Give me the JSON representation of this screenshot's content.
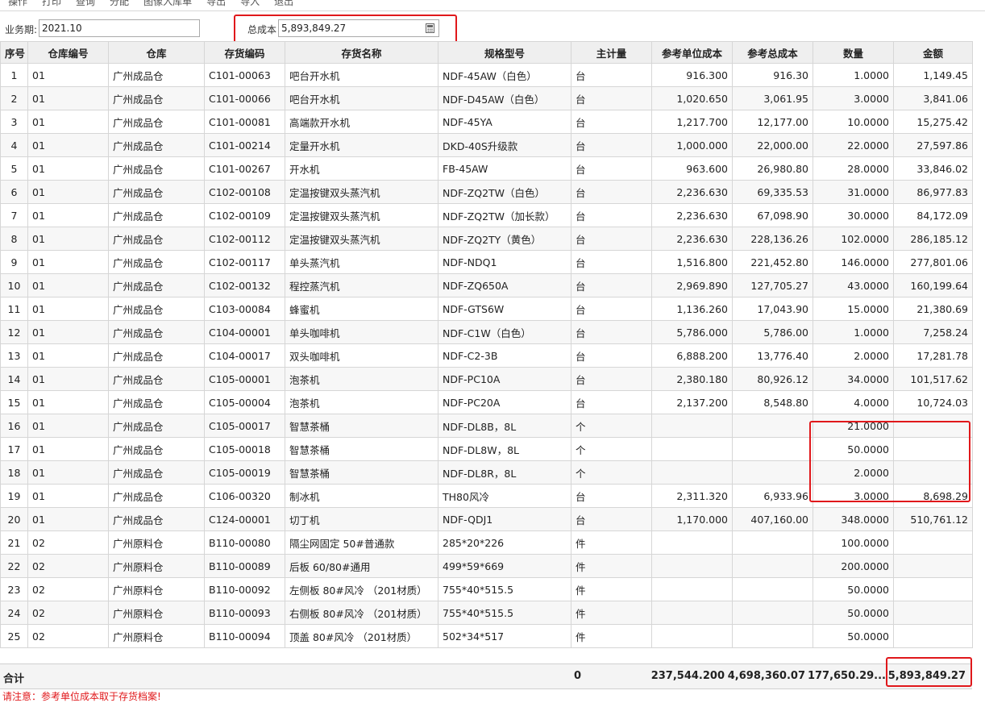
{
  "toolbar": [
    "操作",
    "打印",
    "查询",
    "分配",
    "图像入库单",
    "导出",
    "导入",
    "退出"
  ],
  "filters": {
    "period_label": "业务期:",
    "period_value": "2021.10",
    "total_cost_label": "总成本",
    "total_cost_value": "5,893,849.27"
  },
  "columns": [
    "序号",
    "仓库编号",
    "仓库",
    "存货编码",
    "存货名称",
    "规格型号",
    "主计量",
    "参考单位成本",
    "参考总成本",
    "数量",
    "金额"
  ],
  "rows": [
    [
      "1",
      "01",
      "广州成品仓",
      "C101-00063",
      "吧台开水机",
      "NDF-45AW（白色）",
      "台",
      "916.300",
      "916.30",
      "1.0000",
      "1,149.45"
    ],
    [
      "2",
      "01",
      "广州成品仓",
      "C101-00066",
      "吧台开水机",
      "NDF-D45AW（白色）",
      "台",
      "1,020.650",
      "3,061.95",
      "3.0000",
      "3,841.06"
    ],
    [
      "3",
      "01",
      "广州成品仓",
      "C101-00081",
      "高端款开水机",
      "NDF-45YA",
      "台",
      "1,217.700",
      "12,177.00",
      "10.0000",
      "15,275.42"
    ],
    [
      "4",
      "01",
      "广州成品仓",
      "C101-00214",
      "定量开水机",
      "DKD-40S升级款",
      "台",
      "1,000.000",
      "22,000.00",
      "22.0000",
      "27,597.86"
    ],
    [
      "5",
      "01",
      "广州成品仓",
      "C101-00267",
      "开水机",
      "FB-45AW",
      "台",
      "963.600",
      "26,980.80",
      "28.0000",
      "33,846.02"
    ],
    [
      "6",
      "01",
      "广州成品仓",
      "C102-00108",
      "定温按键双头蒸汽机",
      "NDF-ZQ2TW（白色）",
      "台",
      "2,236.630",
      "69,335.53",
      "31.0000",
      "86,977.83"
    ],
    [
      "7",
      "01",
      "广州成品仓",
      "C102-00109",
      "定温按键双头蒸汽机",
      "NDF-ZQ2TW（加长款）",
      "台",
      "2,236.630",
      "67,098.90",
      "30.0000",
      "84,172.09"
    ],
    [
      "8",
      "01",
      "广州成品仓",
      "C102-00112",
      "定温按键双头蒸汽机",
      "NDF-ZQ2TY（黄色）",
      "台",
      "2,236.630",
      "228,136.26",
      "102.0000",
      "286,185.12"
    ],
    [
      "9",
      "01",
      "广州成品仓",
      "C102-00117",
      "单头蒸汽机",
      "NDF-NDQ1",
      "台",
      "1,516.800",
      "221,452.80",
      "146.0000",
      "277,801.06"
    ],
    [
      "10",
      "01",
      "广州成品仓",
      "C102-00132",
      "程控蒸汽机",
      "NDF-ZQ650A",
      "台",
      "2,969.890",
      "127,705.27",
      "43.0000",
      "160,199.64"
    ],
    [
      "11",
      "01",
      "广州成品仓",
      "C103-00084",
      "蜂蜜机",
      "NDF-GTS6W",
      "台",
      "1,136.260",
      "17,043.90",
      "15.0000",
      "21,380.69"
    ],
    [
      "12",
      "01",
      "广州成品仓",
      "C104-00001",
      "单头咖啡机",
      "NDF-C1W（白色）",
      "台",
      "5,786.000",
      "5,786.00",
      "1.0000",
      "7,258.24"
    ],
    [
      "13",
      "01",
      "广州成品仓",
      "C104-00017",
      "双头咖啡机",
      "NDF-C2-3B",
      "台",
      "6,888.200",
      "13,776.40",
      "2.0000",
      "17,281.78"
    ],
    [
      "14",
      "01",
      "广州成品仓",
      "C105-00001",
      "泡茶机",
      "NDF-PC10A",
      "台",
      "2,380.180",
      "80,926.12",
      "34.0000",
      "101,517.62"
    ],
    [
      "15",
      "01",
      "广州成品仓",
      "C105-00004",
      "泡茶机",
      "NDF-PC20A",
      "台",
      "2,137.200",
      "8,548.80",
      "4.0000",
      "10,724.03"
    ],
    [
      "16",
      "01",
      "广州成品仓",
      "C105-00017",
      "智慧茶桶",
      "NDF-DL8B，8L",
      "个",
      "",
      "",
      "21.0000",
      ""
    ],
    [
      "17",
      "01",
      "广州成品仓",
      "C105-00018",
      "智慧茶桶",
      "NDF-DL8W，8L",
      "个",
      "",
      "",
      "50.0000",
      ""
    ],
    [
      "18",
      "01",
      "广州成品仓",
      "C105-00019",
      "智慧茶桶",
      "NDF-DL8R，8L",
      "个",
      "",
      "",
      "2.0000",
      ""
    ],
    [
      "19",
      "01",
      "广州成品仓",
      "C106-00320",
      "制冰机",
      "TH80风冷",
      "台",
      "2,311.320",
      "6,933.96",
      "3.0000",
      "8,698.29"
    ],
    [
      "20",
      "01",
      "广州成品仓",
      "C124-00001",
      "切丁机",
      "NDF-QDJ1",
      "台",
      "1,170.000",
      "407,160.00",
      "348.0000",
      "510,761.12"
    ],
    [
      "21",
      "02",
      "广州原料仓",
      "B110-00080",
      "隔尘网固定 50#普通款",
      "285*20*226",
      "件",
      "",
      "",
      "100.0000",
      ""
    ],
    [
      "22",
      "02",
      "广州原料仓",
      "B110-00089",
      "后板 60/80#通用",
      "499*59*669",
      "件",
      "",
      "",
      "200.0000",
      ""
    ],
    [
      "23",
      "02",
      "广州原料仓",
      "B110-00092",
      "左侧板 80#风冷 （201材质）",
      "755*40*515.5",
      "件",
      "",
      "",
      "50.0000",
      ""
    ],
    [
      "24",
      "02",
      "广州原料仓",
      "B110-00093",
      "右侧板 80#风冷 （201材质）",
      "755*40*515.5",
      "件",
      "",
      "",
      "50.0000",
      ""
    ],
    [
      "25",
      "02",
      "广州原料仓",
      "B110-00094",
      "顶盖 80#风冷 （201材质）",
      "502*34*517",
      "件",
      "",
      "",
      "50.0000",
      ""
    ]
  ],
  "summary": {
    "label": "合计",
    "main_unit": "0",
    "unit_cost": "237,544.200",
    "total_cost": "4,698,360.07",
    "quantity": "177,650.29...",
    "amount": "5,893,849.27"
  },
  "note": "请注意：参考单位成本取于存货档案!",
  "colors": {
    "highlight": "#e0181b",
    "header_bg": "#efefef"
  }
}
